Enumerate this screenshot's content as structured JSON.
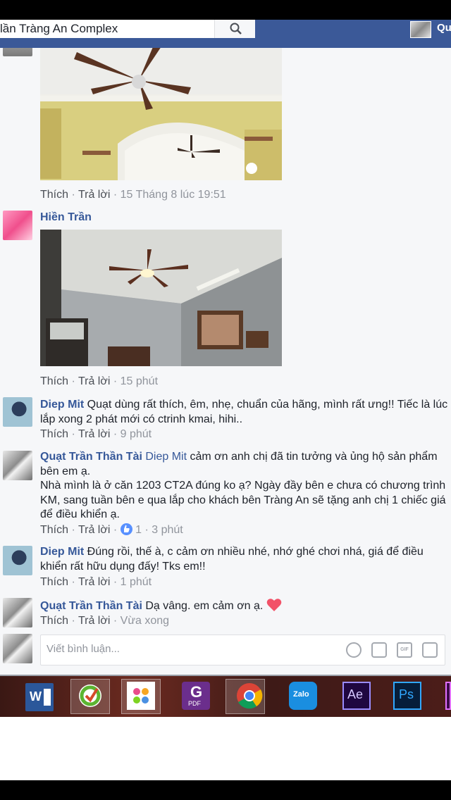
{
  "header": {
    "search_text": "lần Tràng An Complex",
    "user_name": "Qu"
  },
  "photo_comment_1": {
    "like": "Thích",
    "reply": "Trả lời",
    "time": "15 Tháng 8 lúc 19:51"
  },
  "photo_comment_2": {
    "author": "Hiền Trần",
    "like": "Thích",
    "reply": "Trả lời",
    "time": "15 phút"
  },
  "comment_diep_1": {
    "author": "Diep Mit",
    "text": "Quạt dùng rất thích, êm, nhẹ, chuẩn của hãng, mình rất ưng!! Tiếc là lúc lắp xong 2 phát mới có ctrinh kmai, hihi..",
    "like": "Thích",
    "reply": "Trả lời",
    "time": "9 phút"
  },
  "comment_quat_1": {
    "author": "Quạt Trần Thần Tài",
    "tag": "Diep Mit",
    "text": "cảm ơn anh chị đã tin tưởng và ủng hộ sản phẩm bên em ạ.",
    "text2": "Nhà mình là ở căn 1203 CT2A đúng ko ạ? Ngày đầy bên e chưa có chương trình KM, sang tuần bên e qua lắp cho khách bên Tràng An sẽ tặng anh chị 1 chiếc giá để điều khiển ạ.",
    "like": "Thích",
    "reply": "Trả lời",
    "likes": "1",
    "time": "3 phút"
  },
  "comment_diep_2": {
    "author": "Diep Mit",
    "text": "Đúng rồi, thế à, c cảm ơn nhiều nhé, nhớ ghé chơi nhá, giá để điều khiển rất hữu dụng đấy! Tks em!!",
    "like": "Thích",
    "reply": "Trả lời",
    "time": "1 phút"
  },
  "comment_quat_2": {
    "author": "Quạt Trần Thần Tài",
    "text": "Dạ vâng. em cảm ơn ạ.",
    "like": "Thích",
    "reply": "Trả lời",
    "time": "Vừa xong"
  },
  "reply_box": {
    "placeholder": "Viết bình luận..."
  },
  "taskbar": {
    "word": "W",
    "pdf": "PDF",
    "zalo": "Zalo",
    "ae": "Ae",
    "ps": "Ps"
  },
  "colors": {
    "facebook_blue": "#3b5998",
    "link_blue": "#365899",
    "heart": "#f25268"
  }
}
